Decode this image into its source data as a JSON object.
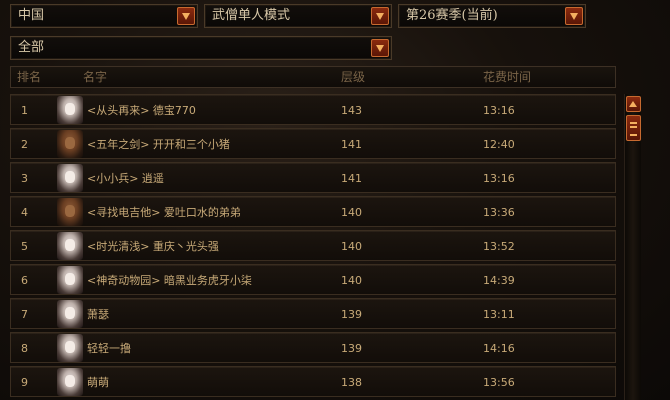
{
  "filters": {
    "region": "中国",
    "mode": "武僧单人模式",
    "season": "第26赛季(当前)",
    "class_filter": "全部"
  },
  "columns": {
    "rank": "排名",
    "name": "名字",
    "level": "层级",
    "time": "花费时间"
  },
  "rows": [
    {
      "rank": "1",
      "name": "<从头再来> 德宝770",
      "level": "143",
      "time": "13:16",
      "avatar": "female-monk"
    },
    {
      "rank": "2",
      "name": "<五年之剑> 开开和三个小猪",
      "level": "141",
      "time": "12:40",
      "avatar": "male-monk"
    },
    {
      "rank": "3",
      "name": "<小小兵> 逍遥",
      "level": "141",
      "time": "13:16",
      "avatar": "female-monk"
    },
    {
      "rank": "4",
      "name": "<寻找电吉他> 爱吐口水的弟弟",
      "level": "140",
      "time": "13:36",
      "avatar": "male-monk"
    },
    {
      "rank": "5",
      "name": "<时光清浅> 重庆丶光头强",
      "level": "140",
      "time": "13:52",
      "avatar": "female-monk"
    },
    {
      "rank": "6",
      "name": "<神奇动物园> 暗黑业务虎牙小柒",
      "level": "140",
      "time": "14:39",
      "avatar": "female-monk"
    },
    {
      "rank": "7",
      "name": "萧瑟",
      "level": "139",
      "time": "13:11",
      "avatar": "female-monk"
    },
    {
      "rank": "8",
      "name": "轻轻一撸",
      "level": "139",
      "time": "14:16",
      "avatar": "female-monk"
    },
    {
      "rank": "9",
      "name": "萌萌",
      "level": "138",
      "time": "13:56",
      "avatar": "female-monk"
    }
  ]
}
